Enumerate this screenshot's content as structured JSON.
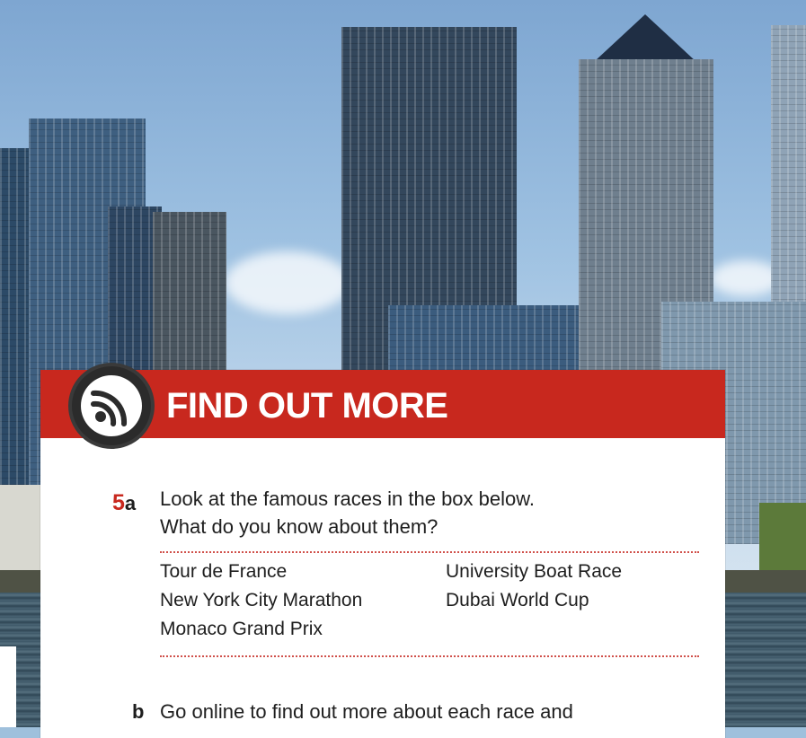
{
  "header": {
    "title": "FIND OUT MORE",
    "icon": "broadcast-icon",
    "color": "#c8281e"
  },
  "exercise_5a": {
    "number": "5",
    "letter": "a",
    "line1": "Look at the famous races in the box below.",
    "line2": "What do you know about them?"
  },
  "races": {
    "left": [
      "Tour de France",
      "New York City Marathon",
      "Monaco Grand Prix"
    ],
    "right": [
      "University Boat Race",
      "Dubai World Cup"
    ]
  },
  "exercise_b": {
    "letter": "b",
    "text": "Go online to find out more about each race and"
  }
}
